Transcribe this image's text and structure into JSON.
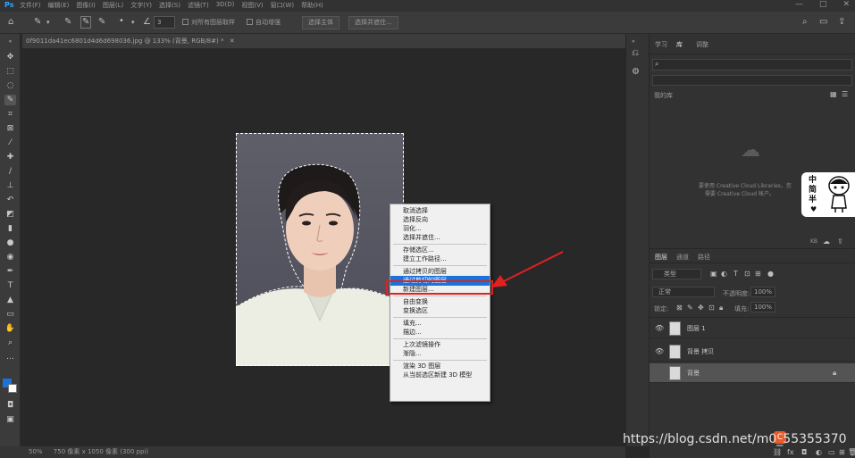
{
  "menubar": {
    "items": [
      "文件(F)",
      "编辑(E)",
      "图像(I)",
      "图层(L)",
      "文字(Y)",
      "选择(S)",
      "滤镜(T)",
      "3D(D)",
      "视图(V)",
      "窗口(W)",
      "帮助(H)"
    ],
    "minimize": "—",
    "maximize": "□",
    "close": "✕"
  },
  "options": {
    "size_value": "3",
    "sample_all_layers": "对所有图层取样",
    "auto_enhance": "自动增强",
    "select_subject": "选择主体",
    "select_and_mask": "选择并遮住..."
  },
  "document": {
    "tab_title": "0f9011da41ec6801d4d6d698036.jpg @ 133% (背景, RGB/8#) *",
    "tab_close": "✕"
  },
  "status": {
    "zoom": "50%",
    "info": "750 像素 x 1050 像素 (300 ppi)"
  },
  "context_menu": {
    "items": [
      "取消选择",
      "选择反向",
      "羽化...",
      "选择并遮住...",
      "存储选区...",
      "建立工作路径...",
      "通过拷贝的图层",
      "通过剪切的图层",
      "新建图层...",
      "自由变换",
      "变换选区",
      "填充...",
      "描边...",
      "上次滤镜操作",
      "渐隐...",
      "渲染 3D 图层",
      "从当前选区新建 3D 模型"
    ],
    "highlighted_index": 7
  },
  "right_panel": {
    "tabs_top": [
      "学习",
      "库",
      "调整"
    ],
    "library_select": "我的库",
    "libraries_empty_text_1": "要使用 Creative Cloud Libraries，您",
    "libraries_empty_text_2": "需要 Creative Cloud 帐户。",
    "layers_tabs": [
      "图层",
      "通道",
      "路径"
    ],
    "filter_kind": "类型",
    "blend_mode": "正常",
    "opacity_label": "不透明度:",
    "opacity_value": "100%",
    "lock_label": "锁定:",
    "fill_label": "填充:",
    "fill_value": "100%",
    "kb_label": "KB",
    "layers": [
      {
        "name": "图层 1"
      },
      {
        "name": "背景 拷贝"
      },
      {
        "name": "背景"
      }
    ]
  },
  "sticker": {
    "text": "中\n简\n半"
  },
  "watermark": "https://blog.csdn.net/m0_55355370",
  "colors": {
    "accent": "#1a73d9",
    "annotation": "#e32020",
    "foreground_swatch": "#1a73d9",
    "background_swatch": "#ffffff"
  }
}
